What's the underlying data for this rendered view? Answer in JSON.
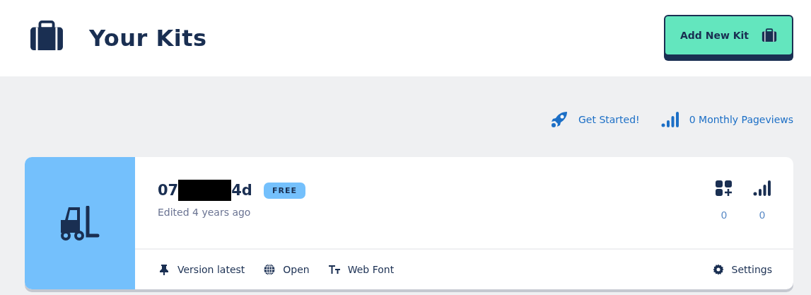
{
  "header": {
    "title": "Your Kits",
    "add_button": "Add New Kit"
  },
  "links": [
    {
      "kind": "rocket",
      "label": "Get Started!"
    },
    {
      "kind": "signal",
      "label": "0 Monthly Pageviews"
    }
  ],
  "kits": [
    {
      "name_start": "07",
      "name_end": "4d",
      "redacted": true,
      "plan": "FREE",
      "edited": "Edited 4 years ago",
      "stats": [
        {
          "kind": "grid",
          "value": "0"
        },
        {
          "kind": "signal",
          "value": "0"
        }
      ],
      "actions": [
        {
          "kind": "pin",
          "label": "Version latest"
        },
        {
          "kind": "globe",
          "label": "Open"
        },
        {
          "kind": "font",
          "label": "Web Font"
        }
      ],
      "settings": "Settings"
    }
  ]
}
